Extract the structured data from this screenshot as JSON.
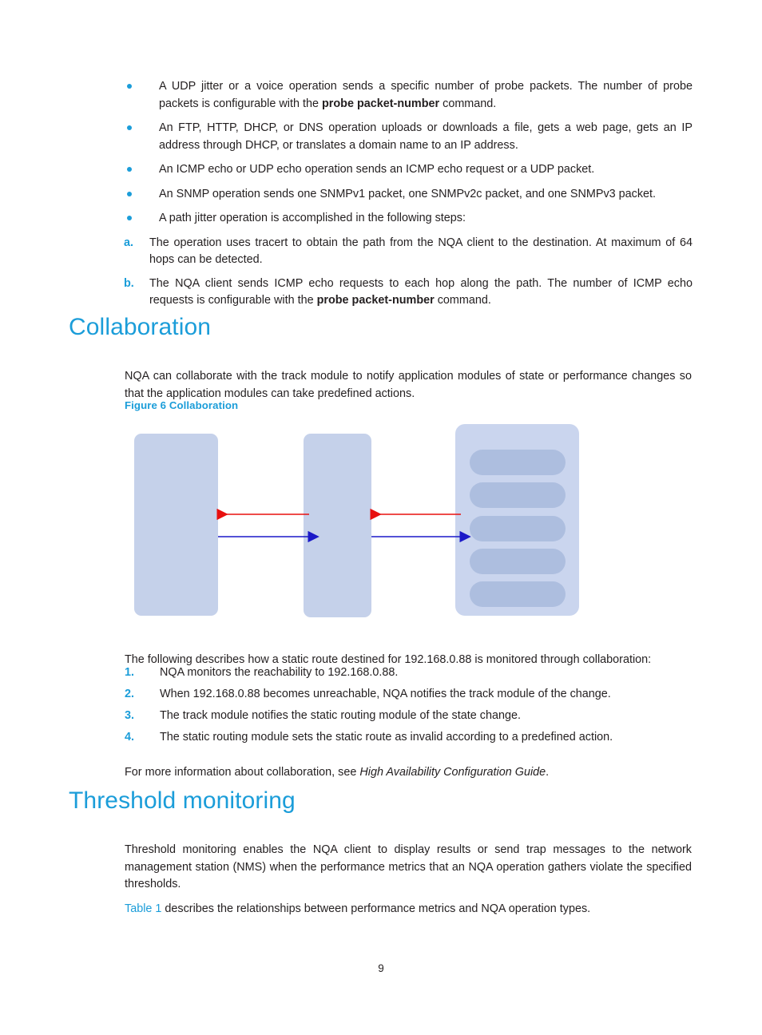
{
  "page": {
    "number": "9"
  },
  "bullets": [
    {
      "marker": "bullet",
      "text_before": "A UDP jitter or a voice operation sends a specific number of probe packets. The number of probe packets is configurable with the ",
      "bold": "probe packet-number",
      "text_after": " command."
    },
    {
      "marker": "bullet",
      "text_before": "An FTP, HTTP, DHCP, or DNS operation uploads or downloads a file, gets a web page, gets an IP address through DHCP, or translates a domain name to an IP address.",
      "bold": "",
      "text_after": ""
    },
    {
      "marker": "bullet",
      "text_before": "An ICMP echo or UDP echo operation sends an ICMP echo request or a UDP packet.",
      "bold": "",
      "text_after": ""
    },
    {
      "marker": "bullet",
      "text_before": "An SNMP operation sends one SNMPv1 packet, one SNMPv2c packet, and one SNMPv3 packet.",
      "bold": "",
      "text_after": ""
    },
    {
      "marker": "bullet",
      "text_before": "A path jitter operation is accomplished in the following steps:",
      "bold": "",
      "text_after": ""
    }
  ],
  "alpha_steps": [
    {
      "marker": "a.",
      "text_before": "The operation uses tracert to obtain the path from the NQA client to the destination. At maximum of 64 hops can be detected.",
      "bold": "",
      "text_after": ""
    },
    {
      "marker": "b.",
      "text_before": "The NQA client sends ICMP echo requests to each hop along the path. The number of ICMP echo requests is configurable with the ",
      "bold": "probe packet-number",
      "text_after": " command."
    }
  ],
  "collaboration": {
    "heading": "Collaboration",
    "body": "NQA can collaborate with the track module to notify application modules of state or performance changes so that the application modules can take predefined actions.",
    "figure_caption": "Figure 6 Collaboration",
    "intro": "The following describes how a static route destined for 192.168.0.88 is monitored through collaboration:",
    "steps": [
      {
        "marker": "1.",
        "text": "NQA monitors the reachability to 192.168.0.88."
      },
      {
        "marker": "2.",
        "text": "When 192.168.0.88 becomes unreachable, NQA notifies the track module of the change."
      },
      {
        "marker": "3.",
        "text": "The track module notifies the static routing module of the state change."
      },
      {
        "marker": "4.",
        "text": "The static routing module sets the static route as invalid according to a predefined action."
      }
    ],
    "more_info_before": "For more information about collaboration, see ",
    "more_info_italic": "High Availability Configuration Guide",
    "more_info_after": "."
  },
  "figure": {
    "boxes": [
      {
        "name": "left-box",
        "label": ""
      },
      {
        "name": "middle-box",
        "label": ""
      },
      {
        "name": "right-box",
        "label": ""
      }
    ],
    "app_slots": [
      {
        "label": ""
      },
      {
        "label": ""
      },
      {
        "label": ""
      },
      {
        "label": ""
      },
      {
        "label": ""
      }
    ],
    "arrows": [
      {
        "name": "left-red-arrow",
        "direction": "left",
        "color": "#e8100f"
      },
      {
        "name": "left-blue-arrow",
        "direction": "right",
        "color": "#1b19c8"
      },
      {
        "name": "right-red-arrow",
        "direction": "left",
        "color": "#e8100f"
      },
      {
        "name": "right-blue-arrow",
        "direction": "right",
        "color": "#1b19c8"
      }
    ],
    "colors": {
      "box_fill": "#c5d1ea",
      "box_fill_outer": "#cad5ee",
      "slot_fill": "#adbedf",
      "red": "#e8100f",
      "blue": "#1b19c8"
    }
  },
  "threshold": {
    "heading": "Threshold monitoring",
    "body": "Threshold monitoring enables the NQA client to display results or send trap messages to the network management station (NMS) when the performance metrics that an NQA operation gathers violate the specified thresholds.",
    "table_link": "Table 1",
    "table_sentence": " describes the relationships between performance metrics and NQA operation types."
  },
  "colors": {
    "accent": "#1b9dd9",
    "text": "#231f20"
  }
}
